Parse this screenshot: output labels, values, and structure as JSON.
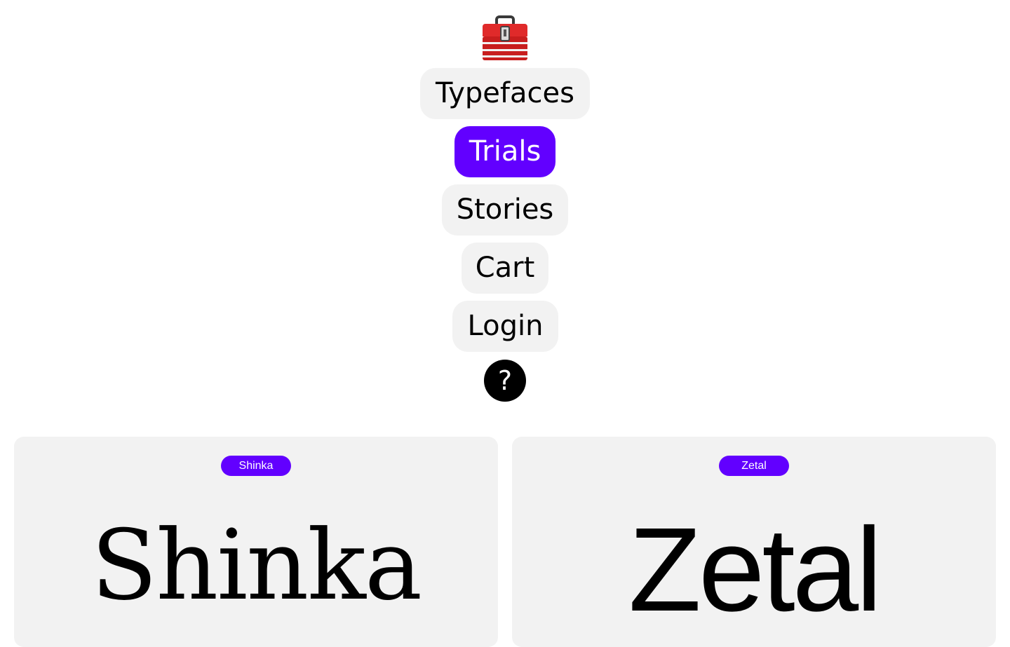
{
  "nav": {
    "logo_icon": "toolbox-icon",
    "items": [
      {
        "label": "Typefaces",
        "active": false
      },
      {
        "label": "Trials",
        "active": true
      },
      {
        "label": "Stories",
        "active": false
      },
      {
        "label": "Cart",
        "active": false
      },
      {
        "label": "Login",
        "active": false
      }
    ],
    "help_label": "?"
  },
  "cards": [
    {
      "tag": "Shinka",
      "specimen": "Shinka"
    },
    {
      "tag": "Zetal",
      "specimen": "Zetal"
    }
  ],
  "colors": {
    "accent": "#6200ff",
    "pill_bg": "#f2f2f2",
    "card_bg": "#f2f2f2",
    "help_bg": "#000000"
  }
}
